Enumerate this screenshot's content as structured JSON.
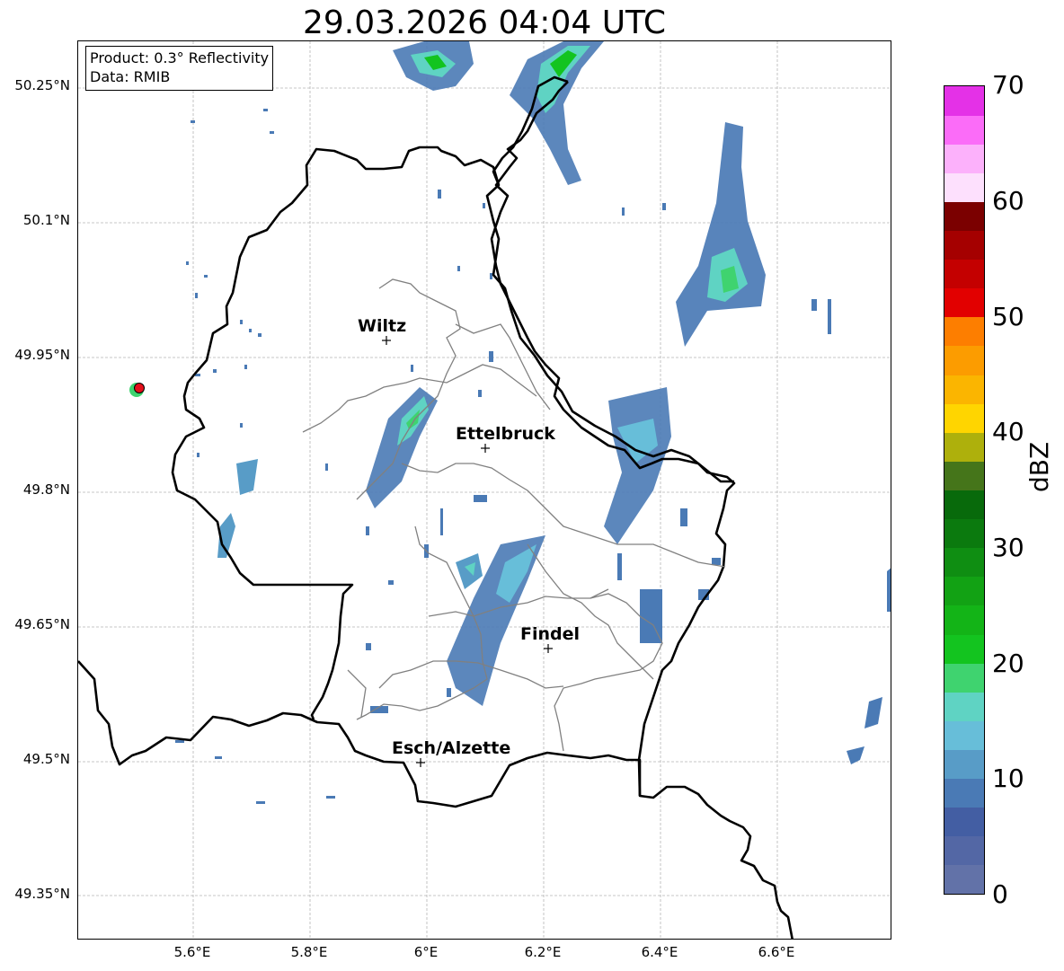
{
  "title": "29.03.2026 04:04 UTC",
  "info": {
    "product": "Product: 0.3° Reflectivity",
    "source": "Data: RMIB"
  },
  "axes": {
    "lat_labels": [
      "50.25°N",
      "50.1°N",
      "49.95°N",
      "49.8°N",
      "49.65°N",
      "49.5°N",
      "49.35°N"
    ],
    "lon_labels": [
      "5.6°E",
      "5.8°E",
      "6°E",
      "6.2°E",
      "6.4°E",
      "6.6°E"
    ],
    "gridlines": true
  },
  "cities": [
    {
      "name": "Wiltz"
    },
    {
      "name": "Ettelbruck"
    },
    {
      "name": "Findel"
    },
    {
      "name": "Esch/Alzette"
    }
  ],
  "colorbar": {
    "unit": "dBZ",
    "ticks": [
      "70",
      "60",
      "50",
      "40",
      "30",
      "20",
      "10",
      "0"
    ],
    "range": [
      0,
      70
    ],
    "step": 2.5,
    "colors": [
      "#6272a8",
      "#5367a5",
      "#435ea3",
      "#4a7ab5",
      "#589cc7",
      "#67bed9",
      "#5fd3c3",
      "#3fd36f",
      "#13c41f",
      "#13b417",
      "#12a214",
      "#0f8e12",
      "#0b7a0e",
      "#086a0b",
      "#45751a",
      "#aeb00c",
      "#ffd500",
      "#fbb500",
      "#fc9c00",
      "#fd7e00",
      "#e20000",
      "#c40000",
      "#a50000",
      "#7b0000",
      "#fde0fd",
      "#fcb1fb",
      "#fb6cf8",
      "#e431e7"
    ]
  },
  "radar_site": {
    "color": "#e4101a"
  }
}
